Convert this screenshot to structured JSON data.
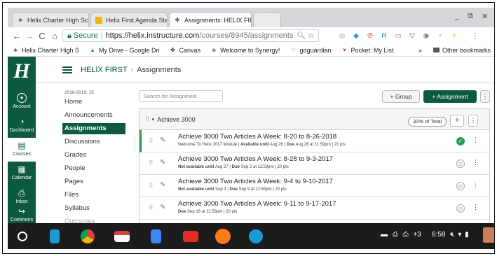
{
  "browser": {
    "tabs": [
      {
        "label": "Helix Charter High Scho",
        "icon": "helix-tab-icon"
      },
      {
        "label": "Helix First Agenda Starr",
        "icon": "slides-tab-icon"
      },
      {
        "label": "Assignments: HELIX FIR",
        "icon": "canvas-tab-icon"
      }
    ],
    "tab_close": "×",
    "secure_label": "Secure",
    "url_host": "https://helix.instructure.com",
    "url_path": "/courses/8945/assignments",
    "bookmarks": [
      {
        "label": "Helix Charter High S",
        "icon": "helix-bookmark-icon"
      },
      {
        "label": "My Drive - Google Dri",
        "icon": "drive-bookmark-icon"
      },
      {
        "label": "Canvas",
        "icon": "canvas-bookmark-icon"
      },
      {
        "label": "Welcome to Synergy!",
        "icon": "synergy-bookmark-icon"
      },
      {
        "label": "goguardian",
        "icon": "goguardian-bookmark-icon"
      },
      {
        "label": "Pocket: My List",
        "icon": "pocket-bookmark-icon"
      }
    ],
    "bookmarks_overflow": "»",
    "other_bookmarks": "Other bookmarks"
  },
  "global_nav": {
    "logo": "H",
    "items": [
      {
        "label": "Account",
        "icon": "account-icon"
      },
      {
        "label": "Dashboard",
        "icon": "dashboard-icon"
      },
      {
        "label": "Courses",
        "icon": "courses-icon"
      },
      {
        "label": "Calendar",
        "icon": "calendar-icon"
      },
      {
        "label": "Inbox",
        "icon": "inbox-icon"
      },
      {
        "label": "Commons",
        "icon": "commons-icon"
      }
    ]
  },
  "breadcrumb": {
    "course": "HELIX FIRST",
    "separator": "›",
    "page": "Assignments"
  },
  "course_nav": {
    "term": "2018-2019: 15",
    "items": [
      {
        "label": "Home"
      },
      {
        "label": "Announcements"
      },
      {
        "label": "Assignments"
      },
      {
        "label": "Discussions"
      },
      {
        "label": "Grades"
      },
      {
        "label": "People"
      },
      {
        "label": "Pages"
      },
      {
        "label": "Files"
      },
      {
        "label": "Syllabus"
      },
      {
        "label": "Outcomes"
      }
    ],
    "active": "Assignments"
  },
  "toolbar": {
    "search_placeholder": "Search for Assignment",
    "group_button": "+ Group",
    "assignment_button": "+ Assignment",
    "kebab": "⋮"
  },
  "assignment_group": {
    "title": "Achieve 3000",
    "percent": "30% of Total",
    "assignments": [
      {
        "title": "Achieve 3000 Two Articles A Week: 8-20 to 8-26-2018",
        "module": "Welcome To Helix 2017 Module",
        "availability_label": "Available until",
        "availability_date": "Aug 26",
        "due_label": "Due",
        "due_date": "Aug 26 at 11:59pm",
        "points": "20 pts",
        "published": true
      },
      {
        "title": "Achieve 3000 Two Articles A Week: 8-28 to 9-3-2017",
        "module": "",
        "availability_label": "Not available until",
        "availability_date": "Aug 27",
        "due_label": "Due",
        "due_date": "Sep 2 at 11:59pm",
        "points": "20 pts",
        "published": false
      },
      {
        "title": "Achieve 3000 Two Articles A Week: 9-4 to 9-10-2017",
        "module": "",
        "availability_label": "Not available until",
        "availability_date": "Sep 3",
        "due_label": "Due",
        "due_date": "Sep 9 at 11:59pm",
        "points": "20 pts",
        "published": false
      },
      {
        "title": "Achieve 3000 Two Articles A Week: 9-11 to 9-17-2017",
        "module": "",
        "availability_label": "",
        "availability_date": "",
        "due_label": "Due",
        "due_date": "Sep 16 at 11:59pm",
        "points": "20 pts",
        "published": false
      }
    ]
  },
  "shelf": {
    "notification_count": "+3",
    "time": "6:58"
  },
  "colors": {
    "canvas_green": "#0e5a3e",
    "published_green": "#2b9d4c",
    "shelf": "#1c1c1c"
  }
}
